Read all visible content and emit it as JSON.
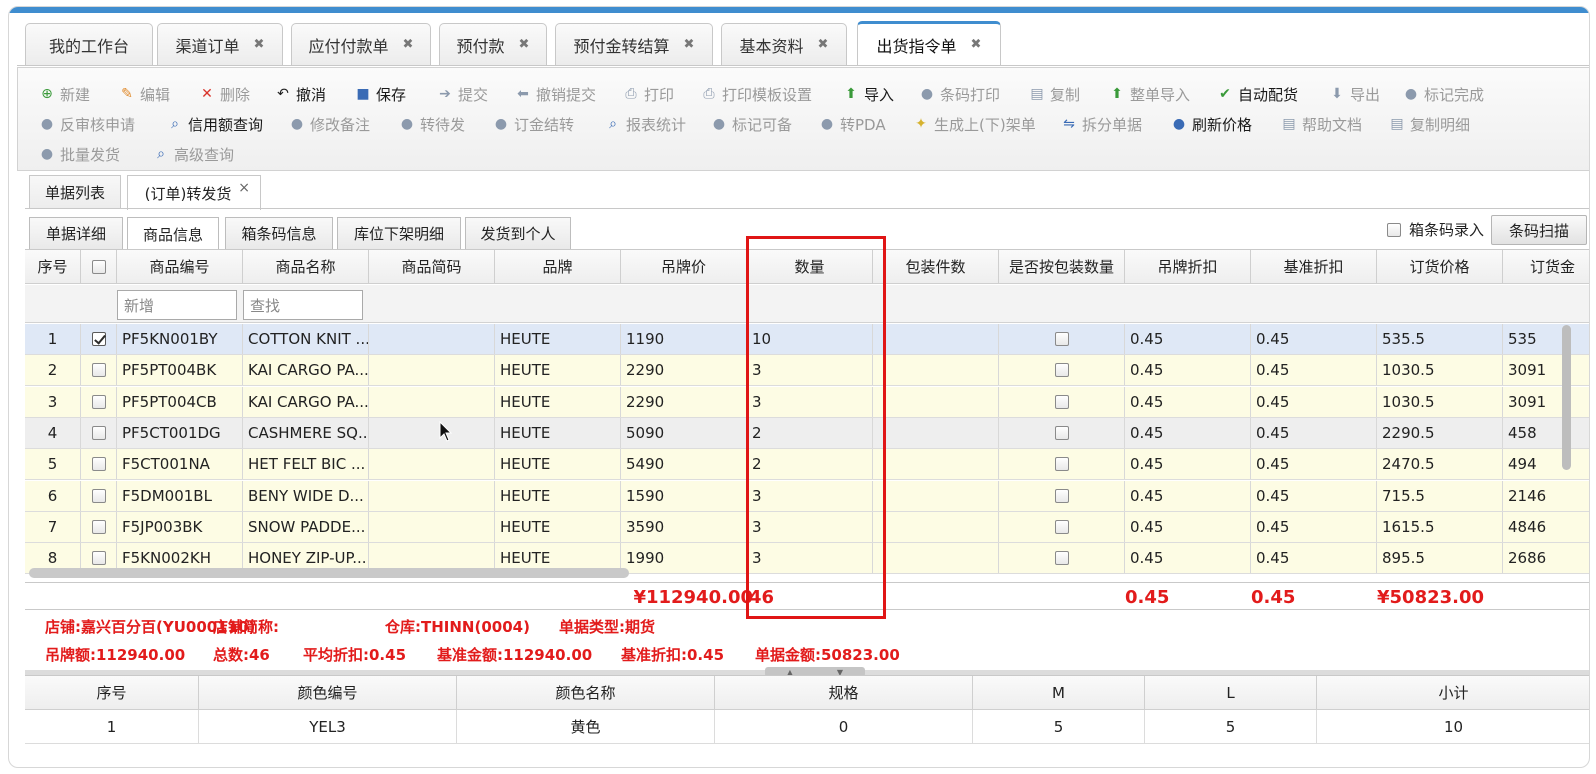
{
  "main_tabs": [
    {
      "label": "我的工作台",
      "closable": false
    },
    {
      "label": "渠道订单",
      "closable": true
    },
    {
      "label": "应付付款单",
      "closable": true
    },
    {
      "label": "预付款",
      "closable": true
    },
    {
      "label": "预付金转结算",
      "closable": true
    },
    {
      "label": "基本资料",
      "closable": true
    },
    {
      "label": "出货指令单",
      "closable": true,
      "active": true
    }
  ],
  "close_glyph": "✖",
  "toolbar": {
    "row1": [
      {
        "label": "新建",
        "icon": "plus-circle-icon",
        "enabled": false
      },
      {
        "label": "编辑",
        "icon": "edit-icon",
        "enabled": false
      },
      {
        "label": "删除",
        "icon": "delete-icon",
        "enabled": false
      },
      {
        "label": "撤消",
        "icon": "undo-icon",
        "enabled": true
      },
      {
        "label": "保存",
        "icon": "save-icon",
        "enabled": true
      },
      {
        "label": "提交",
        "icon": "submit-arrow-icon",
        "enabled": false
      },
      {
        "label": "撤销提交",
        "icon": "revoke-arrow-icon",
        "enabled": false
      },
      {
        "label": "打印",
        "icon": "printer-icon",
        "enabled": false
      },
      {
        "label": "打印模板设置",
        "icon": "printer-icon",
        "enabled": false
      },
      {
        "label": "导入",
        "icon": "import-arrow-icon",
        "enabled": true
      },
      {
        "label": "条码打印",
        "icon": "user-icon",
        "enabled": false
      },
      {
        "label": "复制",
        "icon": "copy-icon",
        "enabled": false
      },
      {
        "label": "整单导入",
        "icon": "import-arrow-icon",
        "enabled": false
      },
      {
        "label": "自动配货",
        "icon": "check-icon",
        "enabled": true
      },
      {
        "label": "导出",
        "icon": "export-arrow-icon",
        "enabled": false
      },
      {
        "label": "标记完成",
        "icon": "user-icon",
        "enabled": false
      }
    ],
    "row2": [
      {
        "label": "反审核申请",
        "icon": "user-icon",
        "enabled": false
      },
      {
        "label": "信用额查询",
        "icon": "search-icon",
        "enabled": true
      },
      {
        "label": "修改备注",
        "icon": "user-icon",
        "enabled": false
      },
      {
        "label": "转待发",
        "icon": "user-icon",
        "enabled": false
      },
      {
        "label": "订金结转",
        "icon": "user-icon",
        "enabled": false
      },
      {
        "label": "报表统计",
        "icon": "search-icon",
        "enabled": false
      },
      {
        "label": "标记可备",
        "icon": "user-icon",
        "enabled": false
      },
      {
        "label": "转PDA",
        "icon": "user-icon",
        "enabled": false
      },
      {
        "label": "生成上(下)架单",
        "icon": "lightbulb-icon",
        "enabled": false
      },
      {
        "label": "拆分单据",
        "icon": "split-icon",
        "enabled": false
      },
      {
        "label": "刷新价格",
        "icon": "user-icon",
        "enabled": true
      },
      {
        "label": "帮助文档",
        "icon": "document-icon",
        "enabled": false
      },
      {
        "label": "复制明细",
        "icon": "document-icon",
        "enabled": false
      }
    ],
    "row3": [
      {
        "label": "批量发货",
        "icon": "user-icon",
        "enabled": false
      },
      {
        "label": "高级查询",
        "icon": "search-icon",
        "enabled": false
      }
    ]
  },
  "sub_tabs": [
    {
      "label": "单据列表"
    },
    {
      "label": "(订单)转发货",
      "active": true,
      "closable": true
    }
  ],
  "sub_close_glyph": "×",
  "inner_tabs": [
    {
      "label": "单据详细"
    },
    {
      "label": "商品信息",
      "active": true
    },
    {
      "label": "箱条码信息"
    },
    {
      "label": "库位下架明细"
    },
    {
      "label": "发货到个人"
    }
  ],
  "box_code_label": "箱条码录入",
  "scan_button": "条码扫描",
  "grid": {
    "headers": [
      "序号",
      "",
      "商品编号",
      "商品名称",
      "商品简码",
      "品牌",
      "吊牌价",
      "数量",
      "包装件数",
      "是否按包装数量",
      "吊牌折扣",
      "基准折扣",
      "订货价格",
      "订货金"
    ],
    "filter_new_placeholder": "新增",
    "filter_find_placeholder": "查找",
    "rows": [
      {
        "no": "1",
        "checked": true,
        "code": "PF5KN001BY",
        "name": "COTTON KNIT ...",
        "brand": "HEUTE",
        "tag": "1190",
        "qty": "10",
        "tagdisc": "0.45",
        "basedisc": "0.45",
        "price": "535.5",
        "amount": "535"
      },
      {
        "no": "2",
        "checked": false,
        "code": "PF5PT004BK",
        "name": "KAI CARGO PA...",
        "brand": "HEUTE",
        "tag": "2290",
        "qty": "3",
        "tagdisc": "0.45",
        "basedisc": "0.45",
        "price": "1030.5",
        "amount": "3091"
      },
      {
        "no": "3",
        "checked": false,
        "code": "PF5PT004CB",
        "name": "KAI CARGO PA...",
        "brand": "HEUTE",
        "tag": "2290",
        "qty": "3",
        "tagdisc": "0.45",
        "basedisc": "0.45",
        "price": "1030.5",
        "amount": "3091"
      },
      {
        "no": "4",
        "checked": false,
        "code": "PF5CT001DG",
        "name": "CASHMERE SQ...",
        "brand": "HEUTE",
        "tag": "5090",
        "qty": "2",
        "tagdisc": "0.45",
        "basedisc": "0.45",
        "price": "2290.5",
        "amount": "458"
      },
      {
        "no": "5",
        "checked": false,
        "code": "F5CT001NA",
        "name": "HET FELT BIC ...",
        "brand": "HEUTE",
        "tag": "5490",
        "qty": "2",
        "tagdisc": "0.45",
        "basedisc": "0.45",
        "price": "2470.5",
        "amount": "494"
      },
      {
        "no": "6",
        "checked": false,
        "code": "F5DM001BL",
        "name": "BENY WIDE D...",
        "brand": "HEUTE",
        "tag": "1590",
        "qty": "3",
        "tagdisc": "0.45",
        "basedisc": "0.45",
        "price": "715.5",
        "amount": "2146"
      },
      {
        "no": "7",
        "checked": false,
        "code": "F5JP003BK",
        "name": "SNOW PADDE...",
        "brand": "HEUTE",
        "tag": "3590",
        "qty": "3",
        "tagdisc": "0.45",
        "basedisc": "0.45",
        "price": "1615.5",
        "amount": "4846"
      },
      {
        "no": "8",
        "checked": false,
        "code": "F5KN002KH",
        "name": "HONEY ZIP-UP...",
        "brand": "HEUTE",
        "tag": "1990",
        "qty": "3",
        "tagdisc": "0.45",
        "basedisc": "0.45",
        "price": "895.5",
        "amount": "2686"
      }
    ]
  },
  "summary": {
    "tag_total": "¥112940.00",
    "qty_total": "46",
    "tag_disc": "0.45",
    "base_disc": "0.45",
    "price_total": "¥50823.00"
  },
  "info": {
    "line1": [
      "店铺:嘉兴百分百(YU000110)",
      "店铺简称:",
      "仓库:THINN(0004)",
      "单据类型:期货"
    ],
    "line2": [
      "吊牌额:112940.00",
      "总数:46",
      "平均折扣:0.45",
      "基准金额:112940.00",
      "基准折扣:0.45",
      "单据金额:50823.00"
    ]
  },
  "detail": {
    "headers": [
      "序号",
      "颜色编号",
      "颜色名称",
      "规格",
      "M",
      "L",
      "小计"
    ],
    "rows": [
      [
        "1",
        "YEL3",
        "黄色",
        "0",
        "5",
        "5",
        "10"
      ]
    ]
  },
  "colors": {
    "accent": "#3f8dcf",
    "highlight_box": "#e01515",
    "summary_text": "#e21b1b",
    "row_bg": "#fdfce4",
    "selected_row_bg": "#dfe8f6"
  }
}
